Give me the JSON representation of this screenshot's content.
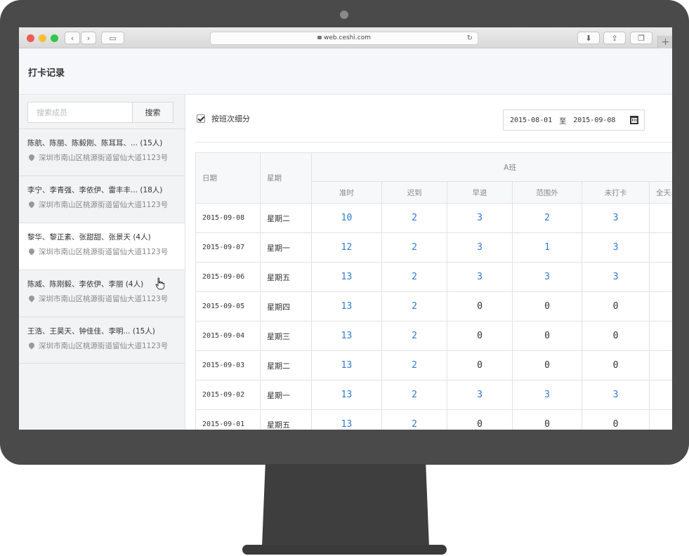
{
  "browser": {
    "url": "web.ceshi.com"
  },
  "page": {
    "title": "打卡记录"
  },
  "sidebar": {
    "search_placeholder": "搜索成员",
    "search_button": "搜索",
    "groups": [
      {
        "name": "陈航、陈丽、陈毅刚、陈耳耳、... (15人)",
        "address": "深圳市南山区桃源街道留仙大道1123号"
      },
      {
        "name": "李宁、李青强、李依伊、雷丰丰... (18人)",
        "address": "深圳市南山区桃源街道留仙大道1123号"
      },
      {
        "name": "黎华、黎正素、张甜甜、张景天 (4人)",
        "address": "深圳市南山区桃源街道留仙大道1123号"
      },
      {
        "name": "陈威、陈刚毅、李依伊、李丽 (4人)",
        "address": "深圳市南山区桃源街道留仙大道1123号"
      },
      {
        "name": "王浩、王昊天、钟佳佳、李明... (15人)",
        "address": "深圳市南山区桃源街道留仙大道1123号"
      }
    ]
  },
  "filters": {
    "by_shift_label": "按班次细分",
    "by_shift_checked": true,
    "date_from": "2015-08-01",
    "date_sep": "至",
    "date_to": "2015-09-08"
  },
  "table": {
    "col_date": "日期",
    "col_weekday": "星期",
    "shift_name": "A班",
    "sub_cols": [
      "准时",
      "迟到",
      "早退",
      "范围外",
      "未打卡",
      "全天"
    ],
    "rows": [
      {
        "date": "2015-09-08",
        "weekday": "星期二",
        "values": [
          "10",
          "2",
          "3",
          "2",
          "3",
          ""
        ]
      },
      {
        "date": "2015-09-07",
        "weekday": "星期一",
        "values": [
          "12",
          "2",
          "3",
          "1",
          "3",
          ""
        ]
      },
      {
        "date": "2015-09-06",
        "weekday": "星期五",
        "values": [
          "13",
          "2",
          "3",
          "3",
          "3",
          ""
        ]
      },
      {
        "date": "2015-09-05",
        "weekday": "星期四",
        "values": [
          "13",
          "2",
          "0",
          "0",
          "0",
          ""
        ]
      },
      {
        "date": "2015-09-04",
        "weekday": "星期三",
        "values": [
          "13",
          "2",
          "0",
          "0",
          "0",
          ""
        ]
      },
      {
        "date": "2015-09-03",
        "weekday": "星期二",
        "values": [
          "13",
          "2",
          "0",
          "0",
          "0",
          ""
        ]
      },
      {
        "date": "2015-09-02",
        "weekday": "星期一",
        "values": [
          "13",
          "2",
          "3",
          "3",
          "3",
          ""
        ]
      },
      {
        "date": "2015-09-01",
        "weekday": "星期五",
        "values": [
          "13",
          "2",
          "0",
          "0",
          "0",
          ""
        ]
      }
    ]
  },
  "colors": {
    "link": "#2e7ad0",
    "sidebar_bg": "#f2f3f5",
    "header_bg": "#f6f7fb",
    "monitor": "#4a4a4a"
  },
  "icons": [
    "lock-icon",
    "reload-icon",
    "pin-icon",
    "checkbox-icon",
    "calendar-icon",
    "cursor-icon"
  ]
}
